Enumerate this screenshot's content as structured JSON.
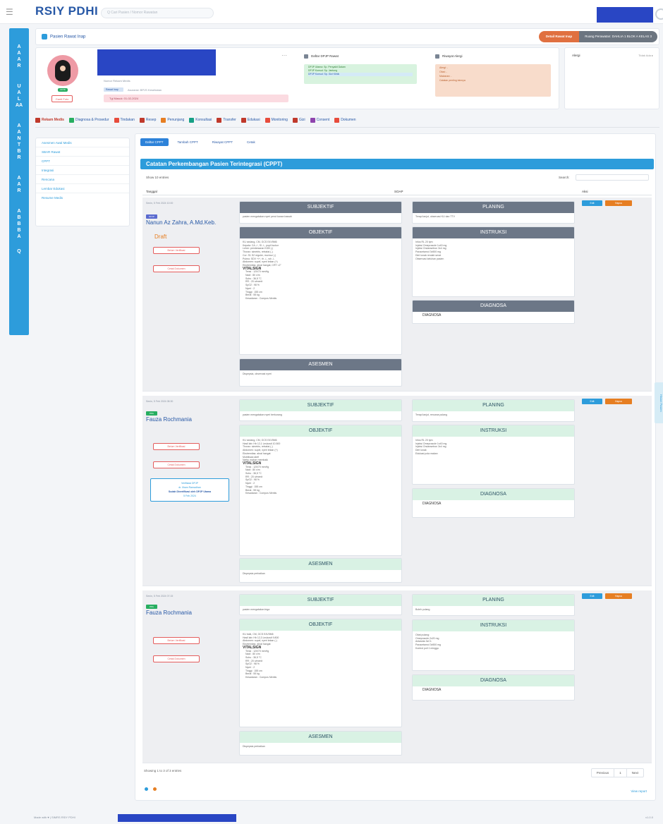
{
  "app": {
    "brand": "RSIY PDHI",
    "search_placeholder": "Q Cari Pasien / Nomor Rawatan"
  },
  "breadcrumb": "Pasien Rawat Inap",
  "ri_button": "Detail Rawat Inap",
  "ri_info": "Ruang Perawatan: DAHLIA 1 BLOK A KELAS 3",
  "patient": {
    "badge": "AKTIF",
    "upload_btn": "Ganti Foto",
    "line1": "Nomor Rekam Medis",
    "line2": "Rawat Inap",
    "line3": "Asuransi: BPJS Kesehatan",
    "info": "Tgl Masuk: 01-02-2024"
  },
  "care": {
    "title": "Daftar DPJP Rawat",
    "items": [
      "DPJP Utama: Sp. Penyakit Dalam",
      "DPJP Konsul: Sp. Jantung",
      "DPJP Konsul: Sp. Gizi Klinik"
    ]
  },
  "hist": {
    "title": "Riwayat Alergi",
    "items": [
      "Alergi: -",
      "Obat: -",
      "Makanan: -",
      "Catatan penting lainnya"
    ]
  },
  "anote": {
    "label": "Alergi",
    "right": "Tidak Ada ▸"
  },
  "tabs": [
    "Rekam Medis",
    "Diagnosa & Prosedur",
    "Tindakan",
    "Resep",
    "Penunjang",
    "Konsultasi",
    "Transfer",
    "Edukasi",
    "Monitoring",
    "Gizi",
    "Consent",
    "Dokumen"
  ],
  "left_menu": [
    "Asesmen Awal Medis",
    "SBAR Rawat",
    "CPPT",
    "Integrasi",
    "Rencana",
    "Lembar Edukasi",
    "Resume Medis"
  ],
  "sub_tabs": [
    "Daftar CPPT",
    "Tambah CPPT",
    "Riwayat CPPT",
    "Cetak"
  ],
  "cppt_title": "Catatan Perkembangan Pasien Terintegrasi (CPPT)",
  "table": {
    "show": "Show 10 entries",
    "search_label": "Search:",
    "col_tanggal": "Tanggal",
    "col_soap": "SOAP",
    "col_aksi": "Aksi"
  },
  "labels": {
    "subjektif": "SUBJEKTIF",
    "objektif": "OBJEKTIF",
    "asesmen": "ASESMEN",
    "planing": "PLANING",
    "instruksi": "INSTRUKSI",
    "diagnosa": "DIAGNOSA",
    "vitalsign": "VITALSIGN",
    "edit": "Edit",
    "delete": "Hapus",
    "verif": "Verifikasi",
    "diag_value": "DIAGNOSA"
  },
  "rows": [
    {
      "date": "Senin, 5 Feb 2024 10:00",
      "badge": "DPJP",
      "name": "Nanun Az Zahra, A.Md.Keb.",
      "status": "Draft",
      "btn1": "Belum Verifikasi",
      "btn2": "Cetak Dokumen"
    },
    {
      "date": "Senin, 5 Feb 2024 08:30",
      "badge": "PPA",
      "name": "Fauza Rochmania",
      "btn1": "Belum Verifikasi",
      "btn2": "Cetak Dokumen",
      "verified": [
        "Verifikasi DPJP",
        "dr. Ilham Ramadhan",
        "Sudah Diverifikasi oleh DPJP Utama",
        "5 Feb 2024"
      ]
    },
    {
      "date": "Senin, 5 Feb 2024 07:15",
      "badge": "PPA",
      "name": "Fauza Rochmania",
      "btn1": "Belum Verifikasi",
      "btn2": "Cetak Dokumen"
    }
  ],
  "vitals": [
    "Tensi : 120/70 mmHg",
    "Nadi : 80 x/m",
    "Suhu : 36,5 °C",
    "RR : 20 x/menit",
    "SpO2 : 98 %",
    "Nyeri : 2",
    "Tinggi : 155 cm",
    "Berat : 55 kg",
    "Kesadaran : Compos Mentis"
  ],
  "showing": "Showing 1 to 3 of 3 entries",
  "pager": [
    "Previous",
    "1",
    "Next"
  ],
  "view_report": "View report",
  "footer": "Made with ♥ | SIMRS RSIY PDHI",
  "version": "v1.0.0",
  "side_tab": "Histori Pasien"
}
